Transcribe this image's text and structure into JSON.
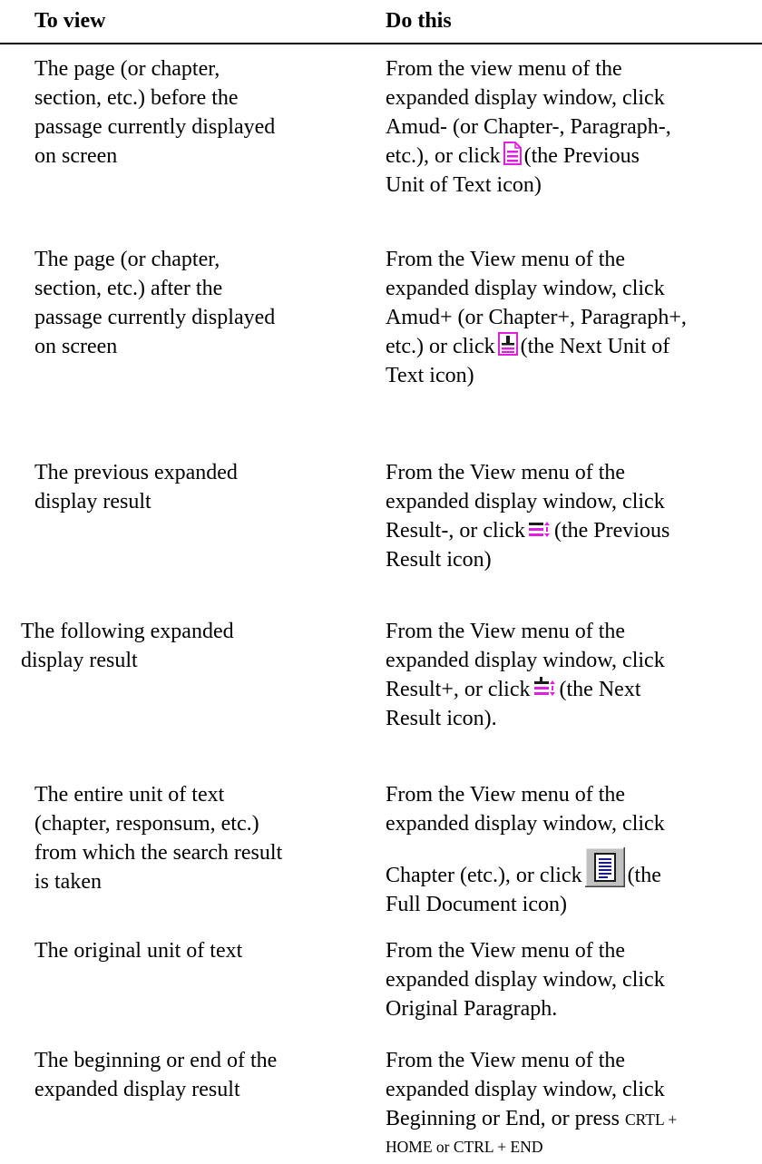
{
  "header": {
    "col1": "To view",
    "col2": "Do this"
  },
  "rows": [
    {
      "left": [
        "The page (or chapter,",
        "section, etc.) before the",
        "passage currently displayed",
        "on screen"
      ],
      "right": {
        "l1": "From the view menu of the",
        "l2": "expanded display window, click",
        "l3": "Amud- (or Chapter-, Paragraph-,",
        "l4a": "etc.), or click",
        "l4b": "(the Previous",
        "l5": "Unit of Text icon)"
      },
      "icon": "previous-unit-of-text-icon"
    },
    {
      "left": [
        "The page (or chapter,",
        "section, etc.) after the",
        "passage currently displayed",
        "on screen"
      ],
      "right": {
        "l1": "From the View menu of the",
        "l2": "expanded display window, click",
        "l3": "Amud+ (or Chapter+, Paragraph+,",
        "l4a": "etc.) or click",
        "l4b": "(the Next Unit of",
        "l5": "Text icon)"
      },
      "icon": "next-unit-of-text-icon"
    },
    {
      "left": [
        "The previous expanded",
        "display result"
      ],
      "right": {
        "l1": "From the View menu of the",
        "l2": "expanded display window, click",
        "l3a": "Result-, or click",
        "l3b": "(the Previous",
        "l4": "Result icon)"
      },
      "icon": "previous-result-icon"
    },
    {
      "left": [
        "The following expanded",
        "display result"
      ],
      "right": {
        "l1": "From the View menu of the",
        "l2": "expanded display window, click",
        "l3a": "Result+, or click",
        "l3b": "(the Next",
        "l4": "Result icon)."
      },
      "icon": "next-result-icon"
    },
    {
      "left": [
        "The entire unit of text",
        "(chapter, responsum, etc.)",
        "from which the search result",
        "is taken"
      ],
      "right": {
        "l1": "From the View menu of the",
        "l2": "expanded display window, click",
        "l3a": "Chapter (etc.), or click",
        "l3b": "(the",
        "l4": "Full Document icon)"
      },
      "icon": "full-document-icon"
    },
    {
      "left": [
        "The original unit of text"
      ],
      "right": {
        "l1": "From the View menu of the",
        "l2": "expanded display window, click",
        "l3": "Original Paragraph."
      }
    },
    {
      "left": [
        "The beginning or end of the",
        "expanded display result"
      ],
      "right": {
        "l1": "From the View menu of the",
        "l2": "expanded display window, click",
        "l3": "Beginning or End, or press",
        "l3sc": "CRTL +",
        "l4sc": "HOME or CTRL + END"
      }
    }
  ],
  "colors": {
    "icon_magenta": "#e020e0",
    "icon_navy": "#1a1a8a",
    "icon_gray": "#c0c0c0"
  }
}
